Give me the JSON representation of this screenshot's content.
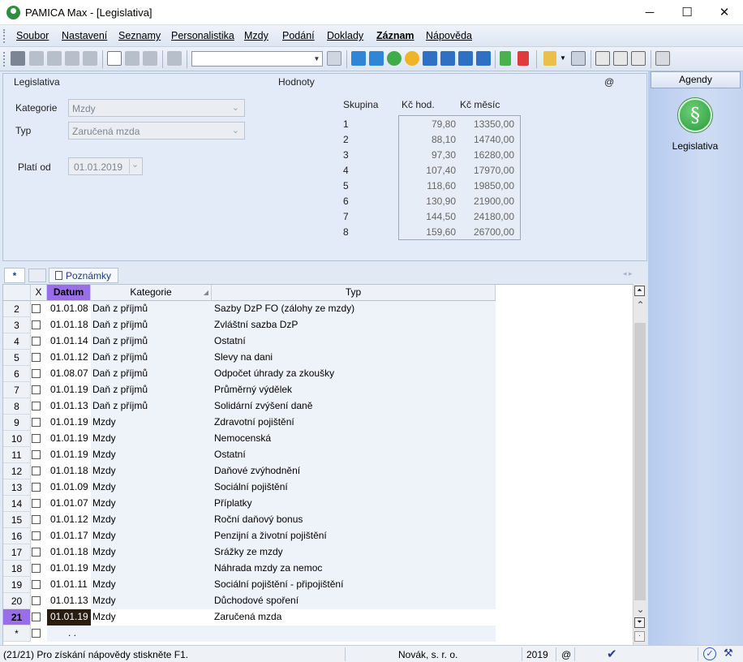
{
  "window": {
    "title": "PAMICA Max - [Legislativa]",
    "minimize": "─",
    "maximize": "☐",
    "close": "✕"
  },
  "menu": [
    "Soubor",
    "Nastavení",
    "Seznamy",
    "Personalistika",
    "Mzdy",
    "Podání",
    "Doklady",
    "Záznam",
    "Nápověda"
  ],
  "form": {
    "section_left": "Legislativa",
    "section_right": "Hodnoty",
    "at_symbol": "@",
    "kategorie_label": "Kategorie",
    "kategorie_value": "Mzdy",
    "typ_label": "Typ",
    "typ_value": "Zaručená mzda",
    "plati_od_label": "Platí od",
    "plati_od_value": "01.01.2019",
    "col_skupina": "Skupina",
    "col_kc_hod": "Kč hod.",
    "col_kc_mesic": "Kč měsíc",
    "values": [
      {
        "skupina": "1",
        "hod": "79,80",
        "mesic": "13350,00"
      },
      {
        "skupina": "2",
        "hod": "88,10",
        "mesic": "14740,00"
      },
      {
        "skupina": "3",
        "hod": "97,30",
        "mesic": "16280,00"
      },
      {
        "skupina": "4",
        "hod": "107,40",
        "mesic": "17970,00"
      },
      {
        "skupina": "5",
        "hod": "118,60",
        "mesic": "19850,00"
      },
      {
        "skupina": "6",
        "hod": "130,90",
        "mesic": "21900,00"
      },
      {
        "skupina": "7",
        "hod": "144,50",
        "mesic": "24180,00"
      },
      {
        "skupina": "8",
        "hod": "159,60",
        "mesic": "26700,00"
      }
    ]
  },
  "tabs": {
    "star": "*",
    "poznamky": "Poznámky"
  },
  "grid": {
    "headers": {
      "x": "X",
      "datum": "Datum",
      "kategorie": "Kategorie",
      "typ": "Typ"
    },
    "new_row_marker": "*",
    "new_row_date": "  .  .",
    "rows": [
      {
        "n": "2",
        "datum": "01.01.08",
        "kategorie": "Daň z příjmů",
        "typ": "Sazby DzP FO (zálohy ze mzdy)"
      },
      {
        "n": "3",
        "datum": "01.01.18",
        "kategorie": "Daň z příjmů",
        "typ": "Zvláštní sazba DzP"
      },
      {
        "n": "4",
        "datum": "01.01.14",
        "kategorie": "Daň z příjmů",
        "typ": "Ostatní"
      },
      {
        "n": "5",
        "datum": "01.01.12",
        "kategorie": "Daň z příjmů",
        "typ": "Slevy na dani"
      },
      {
        "n": "6",
        "datum": "01.08.07",
        "kategorie": "Daň z příjmů",
        "typ": "Odpočet úhrady za zkoušky"
      },
      {
        "n": "7",
        "datum": "01.01.19",
        "kategorie": "Daň z příjmů",
        "typ": "Průměrný výdělek"
      },
      {
        "n": "8",
        "datum": "01.01.13",
        "kategorie": "Daň z příjmů",
        "typ": "Solidární zvýšení daně"
      },
      {
        "n": "9",
        "datum": "01.01.19",
        "kategorie": "Mzdy",
        "typ": "Zdravotní pojištění"
      },
      {
        "n": "10",
        "datum": "01.01.19",
        "kategorie": "Mzdy",
        "typ": "Nemocenská"
      },
      {
        "n": "11",
        "datum": "01.01.19",
        "kategorie": "Mzdy",
        "typ": "Ostatní"
      },
      {
        "n": "12",
        "datum": "01.01.18",
        "kategorie": "Mzdy",
        "typ": "Daňové zvýhodnění"
      },
      {
        "n": "13",
        "datum": "01.01.09",
        "kategorie": "Mzdy",
        "typ": "Sociální pojištění"
      },
      {
        "n": "14",
        "datum": "01.01.07",
        "kategorie": "Mzdy",
        "typ": "Příplatky"
      },
      {
        "n": "15",
        "datum": "01.01.12",
        "kategorie": "Mzdy",
        "typ": "Roční daňový bonus"
      },
      {
        "n": "16",
        "datum": "01.01.17",
        "kategorie": "Mzdy",
        "typ": "Penzijní a životní pojištění"
      },
      {
        "n": "17",
        "datum": "01.01.18",
        "kategorie": "Mzdy",
        "typ": "Srážky ze mzdy"
      },
      {
        "n": "18",
        "datum": "01.01.19",
        "kategorie": "Mzdy",
        "typ": "Náhrada mzdy za nemoc"
      },
      {
        "n": "19",
        "datum": "01.01.11",
        "kategorie": "Mzdy",
        "typ": "Sociální pojištění - připojištění"
      },
      {
        "n": "20",
        "datum": "01.01.13",
        "kategorie": "Mzdy",
        "typ": "Důchodové spoření"
      },
      {
        "n": "21",
        "datum": "01.01.19",
        "kategorie": "Mzdy",
        "typ": "Zaručená mzda"
      }
    ],
    "selected_row": "21"
  },
  "agendy": {
    "header": "Agendy",
    "item_label": "Legislativa",
    "item_symbol": "§"
  },
  "status": {
    "help": "(21/21) Pro získání nápovědy stiskněte F1.",
    "company": "Novák, s. r. o.",
    "year": "2019",
    "at": "@"
  },
  "colors": {
    "accent_purple": "#9a6ee6",
    "selected_cell": "#2b1c10",
    "title_bg": "#ffffff",
    "agendy_panel": "#c3d4f0"
  }
}
